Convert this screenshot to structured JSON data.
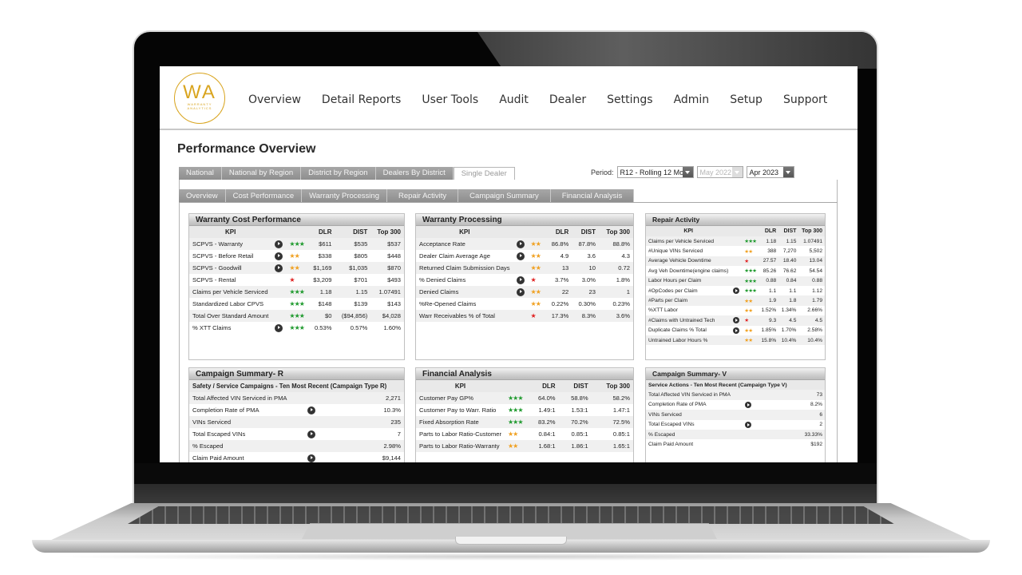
{
  "app": {
    "logo": {
      "initials": "WA",
      "line1": "WARRANTY",
      "line2": "ANALYTICS",
      "color": "#d9a520"
    },
    "nav": [
      "Overview",
      "Detail Reports",
      "User Tools",
      "Audit",
      "Dealer",
      "Settings",
      "Admin",
      "Setup",
      "Support"
    ]
  },
  "page": {
    "title": "Performance Overview",
    "scope_tabs": [
      {
        "label": "National",
        "active": false
      },
      {
        "label": "National by Region",
        "active": false
      },
      {
        "label": "District by Region",
        "active": false
      },
      {
        "label": "Dealers By District",
        "active": false
      },
      {
        "label": "Single Dealer",
        "active": true
      }
    ],
    "section_tabs": [
      "Overview",
      "Cost Performance",
      "Warranty Processing",
      "Repair Activity",
      "Campaign Summary",
      "Financial Analysis"
    ],
    "period": {
      "label": "Period:",
      "period_type": "R12 - Rolling 12 Mo",
      "start": "May 2022",
      "end": "Apr 2023"
    }
  },
  "star_colors": {
    "3": "#1f9a2e",
    "2": "#f0a020",
    "1": "#e02020"
  },
  "panels": {
    "cost": {
      "title": "Warranty Cost Performance",
      "headers": [
        "KPI",
        "DLR",
        "DIST",
        "Top 300"
      ],
      "rows": [
        {
          "kpi": "SCPVS - Warranty",
          "drill": true,
          "stars": 3,
          "dlr": "$611",
          "dist": "$535",
          "top": "$537"
        },
        {
          "kpi": "SCPVS - Before Retail",
          "drill": true,
          "stars": 2,
          "dlr": "$338",
          "dist": "$805",
          "top": "$448"
        },
        {
          "kpi": "SCPVS - Goodwill",
          "drill": true,
          "stars": 2,
          "dlr": "$1,169",
          "dist": "$1,035",
          "top": "$870"
        },
        {
          "kpi": "SCPVS - Rental",
          "drill": false,
          "stars": 1,
          "dlr": "$3,209",
          "dist": "$701",
          "top": "$493"
        },
        {
          "kpi": "Claims per Vehicle Serviced",
          "drill": false,
          "stars": 3,
          "dlr": "1.18",
          "dist": "1.15",
          "top": "1.07491"
        },
        {
          "kpi": "Standardized Labor CPVS",
          "drill": false,
          "stars": 3,
          "dlr": "$148",
          "dist": "$139",
          "top": "$143"
        },
        {
          "kpi": "Total Over Standard Amount",
          "drill": false,
          "stars": 3,
          "dlr": "$0",
          "dist": "($94,856)",
          "top": "$4,028"
        },
        {
          "kpi": "% XTT Claims",
          "drill": true,
          "stars": 3,
          "dlr": "0.53%",
          "dist": "0.57%",
          "top": "1.60%"
        }
      ]
    },
    "processing": {
      "title": "Warranty Processing",
      "headers": [
        "KPI",
        "DLR",
        "DIST",
        "Top 300"
      ],
      "rows": [
        {
          "kpi": "Acceptance Rate",
          "drill": true,
          "stars": 2,
          "dlr": "86.8%",
          "dist": "87.8%",
          "top": "88.8%"
        },
        {
          "kpi": "Dealer Claim Average Age",
          "drill": true,
          "stars": 2,
          "dlr": "4.9",
          "dist": "3.6",
          "top": "4.3"
        },
        {
          "kpi": "Returned Claim Submission Days",
          "drill": false,
          "stars": 2,
          "dlr": "13",
          "dist": "10",
          "top": "0.72"
        },
        {
          "kpi": " % Denied Claims",
          "drill": true,
          "stars": 1,
          "dlr": "3.7%",
          "dist": "3.0%",
          "top": "1.8%"
        },
        {
          "kpi": " Denied Claims",
          "drill": true,
          "stars": 2,
          "dlr": "22",
          "dist": "23",
          "top": "1"
        },
        {
          "kpi": "%Re-Opened Claims",
          "drill": false,
          "stars": 2,
          "dlr": "0.22%",
          "dist": "0.30%",
          "top": "0.23%"
        },
        {
          "kpi": "Warr Receivables % of Total",
          "drill": false,
          "stars": 1,
          "dlr": "17.3%",
          "dist": "8.3%",
          "top": "3.6%"
        }
      ]
    },
    "repair": {
      "title": "Repair Activity",
      "headers": [
        "KPI",
        "DLR",
        "DIST",
        "Top 300"
      ],
      "rows": [
        {
          "kpi": "Claims per Vehicle Serviced",
          "drill": false,
          "stars": 3,
          "dlr": "1.18",
          "dist": "1.15",
          "top": "1.07491"
        },
        {
          "kpi": "#Unique VINs Serviced",
          "drill": false,
          "stars": 2,
          "dlr": "388",
          "dist": "7,270",
          "top": "5,502"
        },
        {
          "kpi": "Average Vehicle Downtime",
          "drill": false,
          "stars": 1,
          "dlr": "27.57",
          "dist": "18.40",
          "top": "13.04"
        },
        {
          "kpi": "Avg Veh Downtime(engine claims)",
          "drill": false,
          "stars": 3,
          "dlr": "85.26",
          "dist": "76.62",
          "top": "54.54"
        },
        {
          "kpi": "Labor Hours per Claim",
          "drill": false,
          "stars": 3,
          "dlr": "0.88",
          "dist": "0.84",
          "top": "0.88"
        },
        {
          "kpi": "#OpCodes per Claim",
          "drill": true,
          "stars": 3,
          "dlr": "1.1",
          "dist": "1.1",
          "top": "1.12"
        },
        {
          "kpi": "#Parts per Claim",
          "drill": false,
          "stars": 2,
          "dlr": "1.9",
          "dist": "1.8",
          "top": "1.79"
        },
        {
          "kpi": "%XTT Labor",
          "drill": false,
          "stars": 2,
          "dlr": "1.52%",
          "dist": "1.34%",
          "top": "2.66%"
        },
        {
          "kpi": "#Claims with Untrained Tech",
          "drill": true,
          "stars": 1,
          "dlr": "9.3",
          "dist": "4.5",
          "top": "4.5"
        },
        {
          "kpi": "Duplicate Claims % Total",
          "drill": true,
          "stars": 2,
          "dlr": "1.85%",
          "dist": "1.70%",
          "top": "2.58%"
        },
        {
          "kpi": "Untrained Labor Hours %",
          "drill": false,
          "stars": 2,
          "dlr": "15.8%",
          "dist": "10.4%",
          "top": "10.4%"
        }
      ]
    },
    "campaign_r": {
      "title": "Campaign Summary- R",
      "subtitle": "Safety / Service Campaigns - Ten Most Recent (Campaign Type R)",
      "rows": [
        {
          "kpi": "Total Affected VIN Serviced in PMA",
          "drill": false,
          "value": "2,271"
        },
        {
          "kpi": "Completion Rate of PMA",
          "drill": true,
          "value": "10.3%"
        },
        {
          "kpi": "VINs Serviced",
          "drill": false,
          "value": "235"
        },
        {
          "kpi": "Total Escaped VINs",
          "drill": true,
          "value": "7"
        },
        {
          "kpi": "% Escaped",
          "drill": false,
          "value": "2.98%"
        },
        {
          "kpi": "Claim Paid Amount",
          "drill": true,
          "value": "$9,144"
        }
      ]
    },
    "financial": {
      "title": "Financial Analysis",
      "headers": [
        "KPI",
        "DLR",
        "DIST",
        "Top 300"
      ],
      "rows": [
        {
          "kpi": "Customer Pay GP%",
          "stars": 3,
          "dlr": "64.0%",
          "dist": "58.8%",
          "top": "58.2%"
        },
        {
          "kpi": "Customer Pay to Warr. Ratio",
          "stars": 3,
          "dlr": "1.49:1",
          "dist": "1.53:1",
          "top": "1.47:1"
        },
        {
          "kpi": "Fixed Absorption Rate",
          "stars": 3,
          "dlr": "83.2%",
          "dist": "70.2%",
          "top": "72.5%"
        },
        {
          "kpi": "Parts to Labor Ratio-Customer",
          "stars": 2,
          "dlr": "0.84:1",
          "dist": "0.85:1",
          "top": "0.85:1"
        },
        {
          "kpi": "Parts to Labor Ratio-Warranty",
          "stars": 2,
          "dlr": "1.68:1",
          "dist": "1.86:1",
          "top": "1.65:1"
        }
      ]
    },
    "campaign_v": {
      "title": "Campaign Summary- V",
      "subtitle": "Service Actions - Ten Most Recent (Campaign Type V)",
      "rows": [
        {
          "kpi": "Total Affected VIN Serviced in PMA",
          "drill": false,
          "value": "73"
        },
        {
          "kpi": "Completion Rate of PMA",
          "drill": true,
          "value": "8.2%"
        },
        {
          "kpi": "VINs Serviced",
          "drill": false,
          "value": "6"
        },
        {
          "kpi": "Total Escaped VINs",
          "drill": true,
          "value": "2"
        },
        {
          "kpi": "% Escaped",
          "drill": false,
          "value": "33.33%"
        },
        {
          "kpi": "Claim Paid Amount",
          "drill": false,
          "value": "$192"
        }
      ]
    }
  }
}
